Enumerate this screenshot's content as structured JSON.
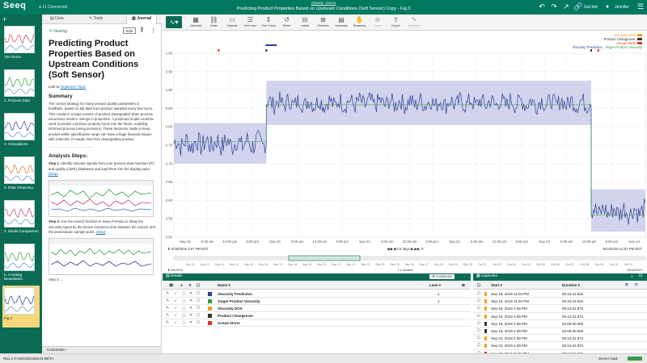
{
  "app": {
    "logo": "Seeq",
    "connection": "11 Connected"
  },
  "header": {
    "breadcrumb": "Shared › Demo",
    "title": "Predicting Product Properties Based on Upstream Conditions (Soft Sensor) Copy - Fig.3",
    "get_link": "Get link",
    "user": "Jennifer"
  },
  "worksteps": [
    {
      "label": "The Demo"
    },
    {
      "label": "1. Process Data"
    },
    {
      "label": "2. Calculations"
    },
    {
      "label": "3. Data Cleansing"
    },
    {
      "label": "4. Model Comparison"
    },
    {
      "label": "5. Creating Boundaries"
    },
    {
      "label": "Fig.3"
    }
  ],
  "journal": {
    "tabs": [
      "Data",
      "Tools",
      "Journal"
    ],
    "viewing": "Viewing",
    "edit": "Edit",
    "title": "Predicting Product Properties Based on Upstream Conditions (Soft Sensor)",
    "link_prefix": "Link to",
    "link_text": "Organizer Topic",
    "summary_heading": "Summary",
    "summary_text": "The control strategy for many product quality parameters is feedback, based on lab data from product sampled every few hours. This results in a large volume of product downgraded when process excursions result in swings in properties. A predicted model could be used to predict a product property hours into the future, enabling informed process tuning decisions. These decisions made to keep product within specification range can have a huge financial impact with reduction in margin loss from downgrading product.",
    "divider": "------------------------------------------",
    "steps_heading": "Analysis Steps:",
    "step1_label": "Step 1.",
    "step1_text": "Identify relevant signals from your process data historian (PI) and quality (LIMS) databases and load them into the display pane.",
    "step1_link": "(Step)",
    "step2_label": "Step 2.",
    "step2_text": "Use the move() function in Seeq Formula to delay the viscosity signal by the known residence time between the reactor and the downstream sample point.",
    "step2_link": "(Step)",
    "step3_partial": "Step 3. ...",
    "comments": "Comments"
  },
  "toolbar": {
    "tools": [
      {
        "icon": "calendar-icon",
        "glyph": "▦",
        "label": "Calendar",
        "enabled": true
      },
      {
        "icon": "chain-icon",
        "glyph": "⛓",
        "label": "Chain",
        "enabled": true
      },
      {
        "icon": "capsule-icon",
        "glyph": "▭",
        "label": "Capsule",
        "enabled": true
      },
      {
        "icon": "one-lane-icon",
        "glyph": "☰",
        "label": "One Lane",
        "enabled": true
      },
      {
        "icon": "one-y-axis-icon",
        "glyph": "⇕",
        "label": "One Y-Axis",
        "enabled": true
      },
      {
        "icon": "reset-icon",
        "glyph": "↺",
        "label": "Reset",
        "enabled": true
      },
      {
        "icon": "labels-icon",
        "glyph": "⊟",
        "label": "Labels",
        "enabled": true
      },
      {
        "icon": "gridlines-icon",
        "glyph": "⊞",
        "label": "Gridlines",
        "enabled": true
      },
      {
        "icon": "summary-icon",
        "glyph": "▤",
        "label": "Summary",
        "enabled": true
      },
      {
        "icon": "browsing-icon",
        "glyph": "✋",
        "label": "Browsing",
        "enabled": true
      },
      {
        "icon": "zoom-icon",
        "glyph": "⊕",
        "label": "Zoom",
        "enabled": false
      },
      {
        "icon": "export-icon",
        "glyph": "⇪",
        "label": "Export",
        "enabled": true
      },
      {
        "icon": "annotate-icon",
        "glyph": "✎",
        "label": "Annotate",
        "enabled": false
      }
    ]
  },
  "legend": {
    "items": [
      {
        "text": "Viscosity DOS",
        "color": "#f0a020"
      },
      {
        "text": "Product Changeover",
        "color": "#333333"
      },
      {
        "text": "Actual Alerts",
        "color": "#e0341a"
      }
    ],
    "line": [
      {
        "text": "Viscosity Prediction,",
        "color": "#2c3c9a"
      },
      {
        "text": "Target Product Viscosity",
        "color": "#2e9e3c"
      }
    ]
  },
  "colors": {
    "band": "#c9cde9",
    "prediction": "#2c3c9a",
    "target": "#2e9e3c",
    "accent": "#0b6b55"
  },
  "chart_data": {
    "type": "line",
    "ylim": [
      0.5,
      1.0
    ],
    "yticks": [
      "1.00",
      "0.95",
      "0.90",
      "0.85",
      "0.80",
      "0.75",
      "0.70",
      "0.65",
      "0.60",
      "0.55",
      "0.50"
    ],
    "xticks": [
      "Sep 19",
      "6:00 am",
      "12:00 pm",
      "6:00 pm",
      "Sep 20",
      "6:00 am",
      "12:00 pm",
      "6:00 pm",
      "Sep 21",
      "6:00 am",
      "12:00 pm",
      "6:00 pm",
      "Sep 22",
      "6:00 am",
      "12:00 pm",
      "6:00 pm",
      "Sep 23",
      "6:00 am",
      "12:00 pm",
      "6:00 pm",
      "Sep 24"
    ],
    "segments": [
      {
        "x_start": 0.0,
        "x_end": 0.196,
        "target": 0.76,
        "band_upper": 0.81,
        "band_lower": 0.7,
        "mean": 0.755,
        "amp": 0.03
      },
      {
        "x_start": 0.196,
        "x_end": 0.885,
        "target": 0.86,
        "band_upper": 0.925,
        "band_lower": 0.805,
        "mean": 0.865,
        "amp": 0.025
      },
      {
        "x_start": 0.885,
        "x_end": 1.0,
        "target": 0.56,
        "band_upper": 0.63,
        "band_lower": 0.515,
        "mean": 0.57,
        "amp": 0.028
      }
    ],
    "series": [
      {
        "name": "Viscosity Prediction"
      },
      {
        "name": "Target Product Viscosity"
      }
    ],
    "range_start": "9/18/2019 2:57 PM EDT",
    "range_end": "9/24/2019 12:57 PM EDT",
    "duration": "5.5 days",
    "nav_ticks": [
      "Sep 11",
      "Sep 12",
      "Sep 13",
      "Sep 14",
      "Sep 15",
      "Sep 16",
      "Sep 17",
      "Sep 18",
      "Sep 19",
      "Sep 20",
      "Sep 21",
      "Sep 22",
      "Sep 23",
      "Sep 24",
      "Sep 25",
      "Sep 26",
      "Sep 27",
      "Sep 28",
      "Sep 29",
      "Sep 30",
      "Oct 01",
      "Oct 02",
      "Oct 03",
      "Oct 04",
      "Oct 05",
      "Oct 06",
      "Oct 07",
      "Oct 08",
      "Oct 09",
      "Oct 10",
      "Oct 11"
    ],
    "nav_start": "9/6/2019",
    "nav_end": "10/16/2019",
    "nav_duration": "1.1 months"
  },
  "details": {
    "title": "Details",
    "customize": "Customize",
    "columns": {
      "name": "Name",
      "lane": "Lane"
    },
    "rows": [
      {
        "name": "Viscosity Prediction",
        "lane": "1",
        "color": "#2c3c9a"
      },
      {
        "name": "Target Product Viscosity",
        "lane": "1",
        "color": "#2e9e3c"
      },
      {
        "name": "Viscosity DOS",
        "lane": "",
        "color": "#f0a020"
      },
      {
        "name": "Product Changeover",
        "lane": "",
        "color": "#333333"
      },
      {
        "name": "Actual Alerts",
        "lane": "",
        "color": "#e0341a"
      }
    ]
  },
  "capsules": {
    "title": "Capsules",
    "columns": {
      "start": "Start",
      "duration": "Duration"
    },
    "rows": [
      {
        "start": "Sep 18, 2019 11:04 PM",
        "duration": "00:10:41.622",
        "color": "#f0a020"
      },
      {
        "start": "Sep 19, 2019 11:04 PM",
        "duration": "00:10:41.622",
        "color": "#f0a020"
      },
      {
        "start": "Sep 19, 2019 4:39 PM",
        "duration": "00:14:22.872",
        "color": "#f0a020"
      },
      {
        "start": "Sep 19, 2019 4:39 PM",
        "duration": "00:14:22.872",
        "color": "#f0a020"
      },
      {
        "start": "Sep 19, 2019 4:39 PM",
        "duration": "02:06:00.000",
        "color": "#333333"
      },
      {
        "start": "Sep 19, 2019 4:39 PM",
        "duration": "02:06:00.000",
        "color": "#333333"
      },
      {
        "start": "Sep 22, 2019 4:39 PM",
        "duration": "00:14:22.872",
        "color": "#f0a020"
      },
      {
        "start": "Sep 22, 2019 4:39 PM",
        "duration": "00:14:22.872",
        "color": "#f0a020"
      },
      {
        "start": "Sep 23, 2019 11:04 PM",
        "duration": "00:12:22.881",
        "color": "#e0341a"
      }
    ]
  },
  "status": {
    "version": "R51.1.0-v201004150441-BETA",
    "server_load": "Server load:"
  }
}
